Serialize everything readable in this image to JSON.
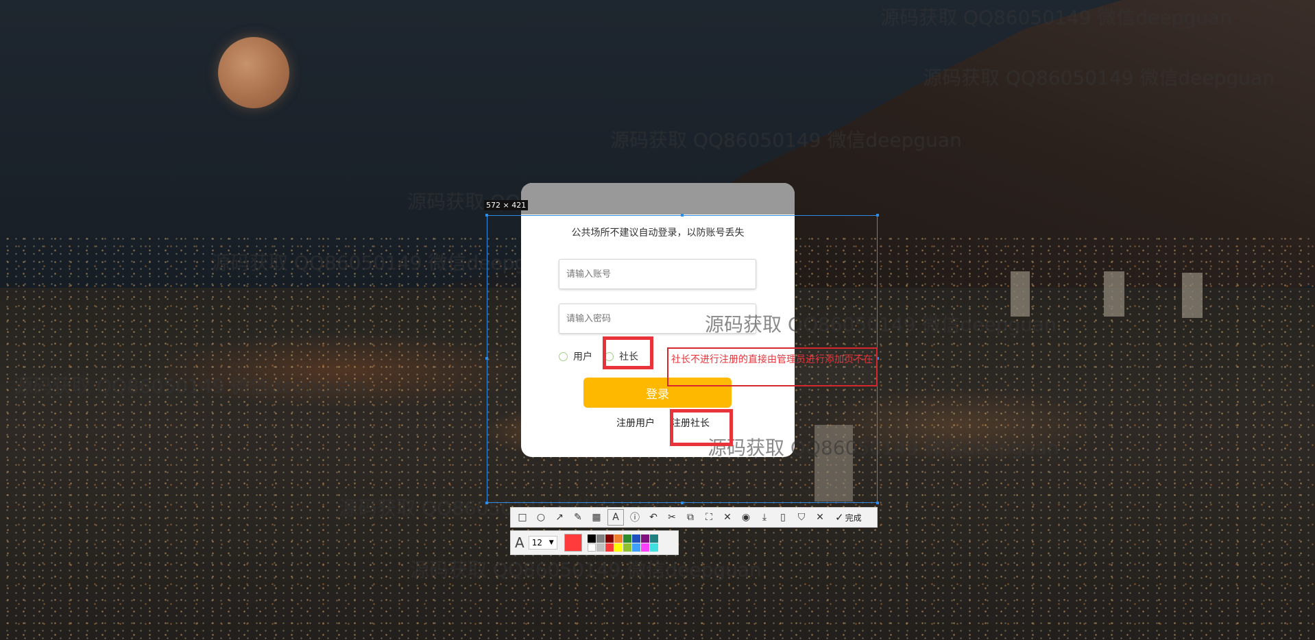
{
  "watermark_text": "源码获取 QQ86050149 微信deepguan",
  "watermarks": [
    "源码获取 QQ86050149 微信deepguan",
    "源码获取 QQ86050149 微信deepguan",
    "源码获取 QQ86050149 微信deepguan",
    "源码获取 QQ86050149 微信deepguan",
    "源码获取 QQ86050149 微信deepguan",
    "源码获取 QQ86050149 微信deepguan",
    "源码获取 QQ86050149 微信deepguan",
    "源码获取 QQ86050149 微信deepguan",
    "源码获取 QQ86050149 微信deepguan",
    "源码获取 QQ86050149 微信deepguan"
  ],
  "login": {
    "tip": "公共场所不建议自动登录，以防账号丢失",
    "username_placeholder": "请输入账号",
    "password_placeholder": "请输入密码",
    "role_user": "用户",
    "role_president": "社长",
    "login_button": "登录",
    "register_user": "注册用户",
    "register_president": "注册社长",
    "button_color": "#ffb800"
  },
  "capture_tool": {
    "selection_size": "572 × 421",
    "annotation_text": "社长不进行注册的直接由管理员进行添加页不在",
    "done_label": "完成",
    "font_size": "12",
    "current_color": "#ff3b3b",
    "palette": [
      "#000000",
      "#808080",
      "#800000",
      "#f08030",
      "#2e8b2e",
      "#2050c0",
      "#801080",
      "#208080",
      "#ffffff",
      "#c0c0c0",
      "#ff3b3b",
      "#ffff00",
      "#90c030",
      "#40a0ff",
      "#ff40ff",
      "#40e0e0"
    ],
    "tool_icons": [
      "rectangle-icon",
      "ellipse-icon",
      "arrow-icon",
      "pen-icon",
      "mosaic-icon",
      "text-icon",
      "number-icon",
      "undo-icon",
      "cut-icon",
      "copy-icon",
      "ocr-icon",
      "pin-icon",
      "record-icon",
      "save-icon",
      "phone-icon",
      "bookmark-icon",
      "close-icon"
    ]
  }
}
